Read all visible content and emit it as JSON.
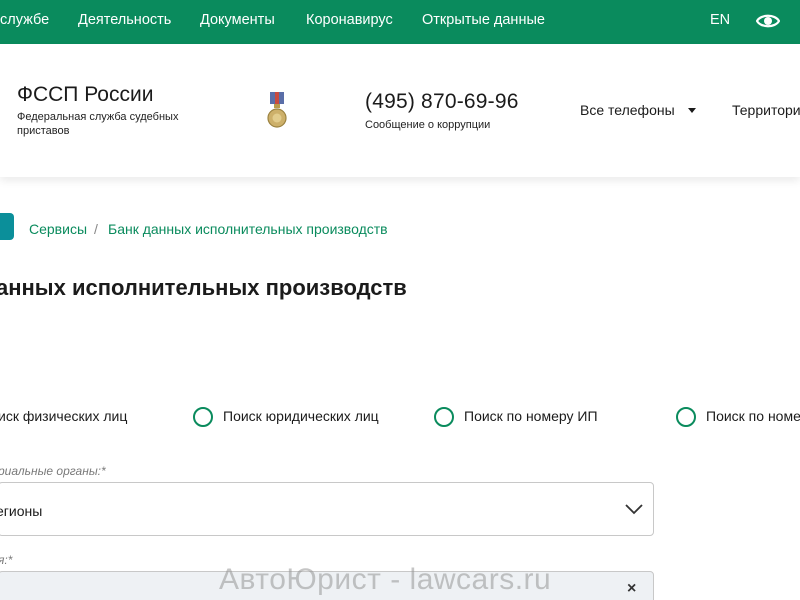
{
  "topnav": {
    "items": [
      "службе",
      "Деятельность",
      "Документы",
      "Коронавирус",
      "Открытые данные"
    ],
    "lang": "EN",
    "visually_impaired_icon": "eye-icon"
  },
  "header": {
    "title": "ФССП России",
    "subtitle": "Федеральная служба судебных приставов",
    "emblem_icon": "medal-icon",
    "phone": "(495) 870-69-96",
    "phone_caption": "Сообщение о коррупции",
    "all_phones": "Все телефоны",
    "territory": "Территори"
  },
  "breadcrumb": {
    "items": [
      "Сервисы",
      "Банк данных исполнительных производств"
    ],
    "separator": "/"
  },
  "page_title": "анных исполнительных производств",
  "search_options": [
    "иск физических лиц",
    "Поиск юридических лиц",
    "Поиск по номеру ИП",
    "Поиск по номе"
  ],
  "form": {
    "territory_label": "риальные органы:*",
    "territory_value": "егионы",
    "second_label": "я:*",
    "clear_symbol": "×"
  },
  "watermark": "АвтоЮрист - lawcars.ru",
  "colors": {
    "brand_green": "#0a8b5d",
    "teal": "#0b8f9a"
  }
}
